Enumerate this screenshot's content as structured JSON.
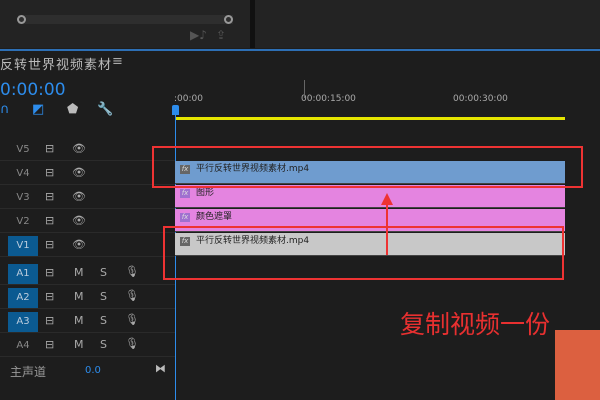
{
  "sequence": {
    "title": "反转世界视频素材",
    "timecode": "0:00:00"
  },
  "ruler": {
    "labels": [
      ":00:00",
      "00:00:15:00",
      "00:00:30:00"
    ]
  },
  "video_tracks": [
    {
      "name": "V5"
    },
    {
      "name": "V4"
    },
    {
      "name": "V3"
    },
    {
      "name": "V2"
    },
    {
      "name": "V1",
      "active": true
    }
  ],
  "audio_tracks": [
    {
      "name": "A1",
      "active": true
    },
    {
      "name": "A2",
      "active": true
    },
    {
      "name": "A3",
      "active": true
    },
    {
      "name": "A4"
    }
  ],
  "mute_label": "M",
  "solo_label": "S",
  "master": {
    "label": "主声道",
    "value": "0.0"
  },
  "clips": {
    "v4": "平行反转世界视频素材.mp4",
    "v3": "图形",
    "v2": "颜色遮罩",
    "v1": "平行反转世界视频素材.mp4"
  },
  "annotation": "复制视频一份",
  "colors": {
    "accent": "#2d8ceb",
    "clip_blue": "#6f9ccf",
    "clip_pink": "#e484e0",
    "clip_gray": "#c8c8c8",
    "highlight": "#ee3333"
  }
}
